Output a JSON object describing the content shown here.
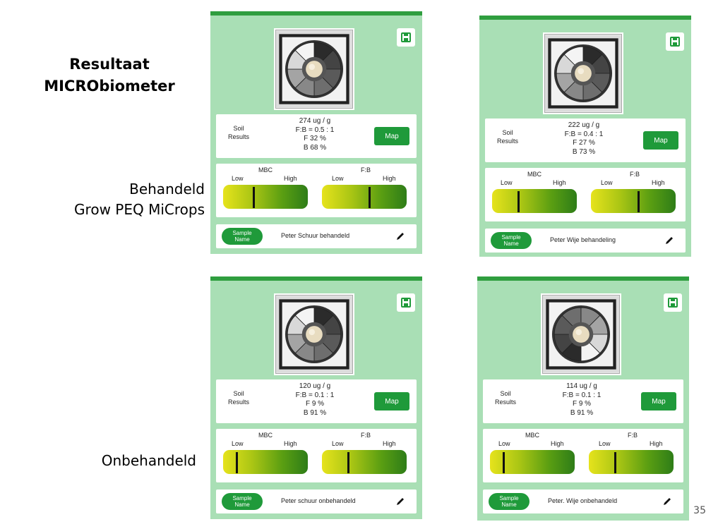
{
  "slide": {
    "title_line1": "Resultaat",
    "title_line2": "MICRObiometer",
    "treated_line1": "Behandeld",
    "treated_line2": "Grow PEQ MiCrops",
    "untreated": "Onbehandeld",
    "page_number": "35"
  },
  "colors": {
    "card_bg": "#a9dfb5",
    "card_top_bar": "#2f9e3f",
    "button_green": "#1f9a3a"
  },
  "common": {
    "soil_label_line1": "Soil",
    "soil_label_line2": "Results",
    "map_label": "Map",
    "mbc_title": "MBC",
    "fb_title": "F:B",
    "low_label": "Low",
    "high_label": "High",
    "sample_label_line1": "Sample",
    "sample_label_line2": "Name",
    "save_icon": "save-icon",
    "edit_icon": "pencil-icon"
  },
  "cards": [
    {
      "mbc": "274 ug / g",
      "fb": "F:B = 0.5 : 1",
      "f": "F 32 %",
      "b": "B 68 %",
      "mbc_level": 0.35,
      "fb_level": 0.55,
      "sample_name": "Peter Schuur behandeld"
    },
    {
      "mbc": "222 ug / g",
      "fb": "F:B = 0.4 : 1",
      "f": "F 27 %",
      "b": "B 73 %",
      "mbc_level": 0.3,
      "fb_level": 0.55,
      "sample_name": "Peter Wije behandeling"
    },
    {
      "mbc": "120 ug / g",
      "fb": "F:B = 0.1 : 1",
      "f": "F 9 %",
      "b": "B 91 %",
      "mbc_level": 0.15,
      "fb_level": 0.3,
      "sample_name": "Peter schuur onbehandeld"
    },
    {
      "mbc": "114 ug / g",
      "fb": "F:B = 0.1 : 1",
      "f": "F 9 %",
      "b": "B 91 %",
      "mbc_level": 0.15,
      "fb_level": 0.3,
      "sample_name": "Peter. Wije onbehandeld"
    }
  ]
}
